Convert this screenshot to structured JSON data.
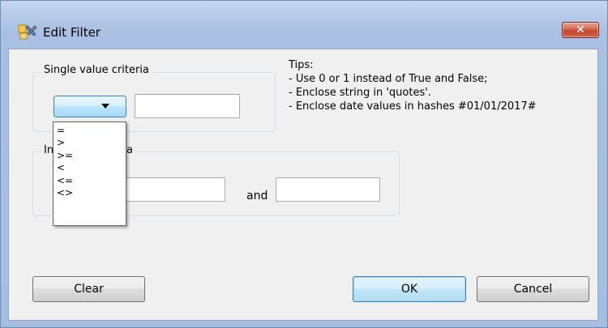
{
  "window": {
    "title": "Edit Filter",
    "close_glyph": "✕",
    "icon": "filter-edit-icon"
  },
  "single": {
    "label": "Single value criteria",
    "combo_value": "",
    "value": ""
  },
  "interval": {
    "label_visible_start": "In",
    "label_visible_end": "a",
    "from_value": "",
    "and_label": "and",
    "to_value": ""
  },
  "operators": [
    "=",
    ">",
    ">=",
    "<",
    "<=",
    "<>"
  ],
  "tips": {
    "heading": "Tips:",
    "lines": [
      "- Use 0 or 1 instead of True and False;",
      "- Enclose string in 'quotes'.",
      "- Enclose date values in hashes #01/01/2017#"
    ]
  },
  "buttons": {
    "clear": "Clear",
    "ok": "OK",
    "cancel": "Cancel"
  },
  "colors": {
    "frame": "#a9c0e2",
    "client": "#f0f0f0",
    "close": "#c4472c",
    "focus": "#3c7fb1"
  }
}
